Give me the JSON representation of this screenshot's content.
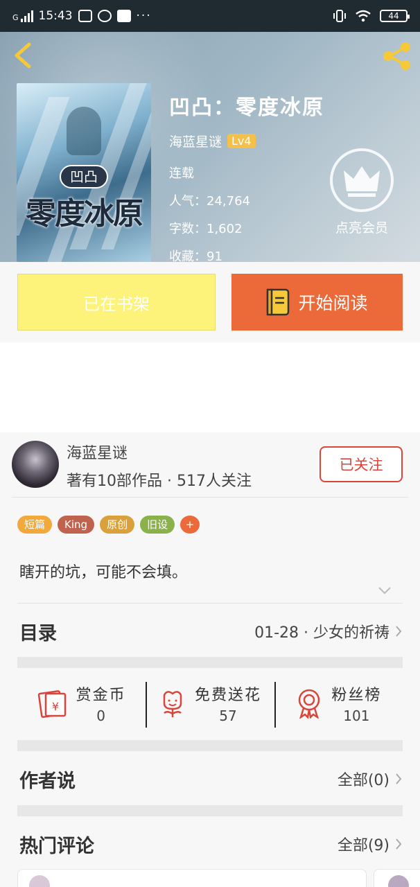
{
  "status_bar": {
    "time": "15:43",
    "network": "G",
    "battery": "44"
  },
  "book": {
    "title": "凹凸：零度冰原",
    "author": "海蓝星谜",
    "level": "Lv4",
    "status": "连载",
    "popularity": "人气：24,764",
    "words": "字数：1,602",
    "favorites": "收藏：91",
    "cover_badge": "凹凸",
    "cover_title": "零度冰原"
  },
  "vip": {
    "label": "点亮会员"
  },
  "actions": {
    "shelf_label": "已在书架",
    "read_label": "开始阅读"
  },
  "author_block": {
    "name": "海蓝星谜",
    "stats": "著有10部作品 · 517人关注",
    "follow_label": "已关注"
  },
  "tags": [
    {
      "label": "短篇",
      "color": "#f2a93b"
    },
    {
      "label": "King",
      "color": "#c0634e"
    },
    {
      "label": "原创",
      "color": "#d9a03c"
    },
    {
      "label": "旧设",
      "color": "#8bb24a"
    },
    {
      "label": "+",
      "color": "#ec6a3a"
    }
  ],
  "description": "瞎开的坑，可能不会填。",
  "toc": {
    "label": "目录",
    "latest": "01-28 · 少女的祈祷"
  },
  "stats": [
    {
      "icon": "red-envelope-icon",
      "label": "赏金币",
      "value": "0"
    },
    {
      "icon": "flower-icon",
      "label": "免费送花",
      "value": "57"
    },
    {
      "icon": "medal-icon",
      "label": "粉丝榜",
      "value": "101"
    }
  ],
  "author_says": {
    "label": "作者说",
    "all_label": "全部(0)"
  },
  "hot_comments": {
    "label": "热门评论",
    "all_label": "全部(9)"
  },
  "colors": {
    "accent": "#ec6a3a",
    "shelf": "#fdf27a",
    "follow": "#d9453a"
  }
}
